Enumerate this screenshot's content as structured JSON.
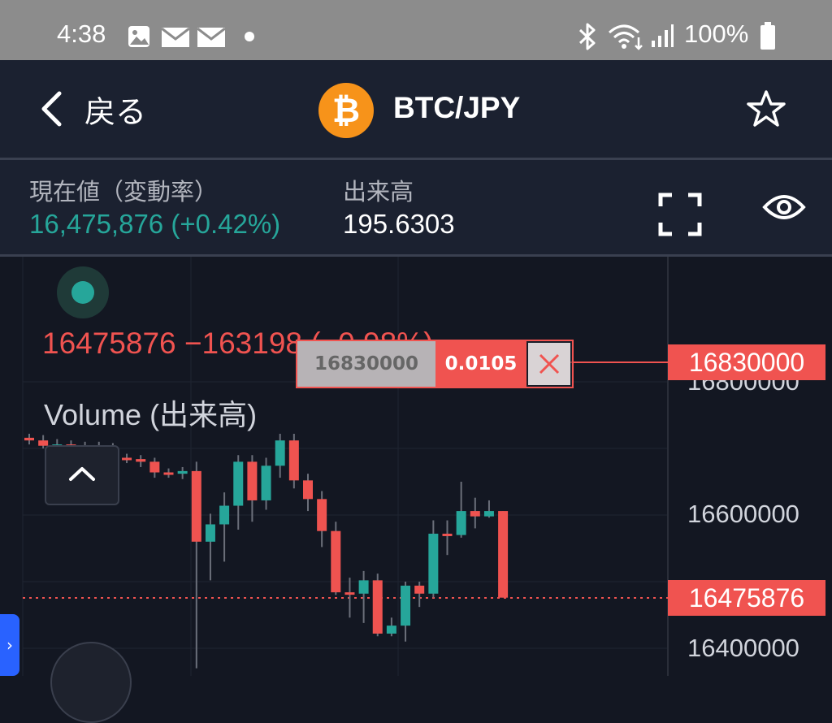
{
  "status_bar": {
    "time": "4:38",
    "battery": "100%",
    "icons": [
      "image-icon",
      "mail-icon",
      "mail-icon",
      "dot-icon",
      "bluetooth-icon",
      "wifi-icon",
      "signal-icon",
      "battery-icon"
    ]
  },
  "header": {
    "back_label": "戻る",
    "coin_symbol": "₿",
    "pair": "BTC/JPY"
  },
  "info": {
    "price_label": "現在値（変動率）",
    "price_value": "16,475,876 (+0.42%)",
    "volume_label": "出来高",
    "volume_value": "195.6303"
  },
  "chart": {
    "legend": "16475876  −163198 (−0.98%)",
    "volume_label": "Volume (出来高)",
    "order": {
      "price": "16830000",
      "qty": "0.0105"
    },
    "tags": {
      "order_price": "16830000",
      "last_price": "16475876"
    },
    "axis_labels": [
      "16800000",
      "16600000",
      "16400000"
    ],
    "colors": {
      "up": "#26a69a",
      "down": "#ef5350",
      "bg": "#131722"
    }
  },
  "chart_data": {
    "type": "candlestick",
    "title": "",
    "axis_range": [
      16400000,
      16800000
    ],
    "current_price": 16475876,
    "order_price": 16830000,
    "candles": [
      {
        "open": 16716000,
        "close": 16712000,
        "high": 16722000,
        "low": 16706000
      },
      {
        "open": 16712000,
        "close": 16704000,
        "high": 16720000,
        "low": 16700000
      },
      {
        "open": 16704000,
        "close": 16706000,
        "high": 16714000,
        "low": 16698000
      },
      {
        "open": 16706000,
        "close": 16703000,
        "high": 16712000,
        "low": 16696000
      },
      {
        "open": 16703000,
        "close": 16704000,
        "high": 16710000,
        "low": 16698000
      },
      {
        "open": 16704000,
        "close": 16702000,
        "high": 16710000,
        "low": 16696000
      },
      {
        "open": 16702000,
        "close": 16686000,
        "high": 16708000,
        "low": 16680000
      },
      {
        "open": 16686000,
        "close": 16684000,
        "high": 16692000,
        "low": 16678000
      },
      {
        "open": 16684000,
        "close": 16680000,
        "high": 16690000,
        "low": 16672000
      },
      {
        "open": 16680000,
        "close": 16664000,
        "high": 16686000,
        "low": 16656000
      },
      {
        "open": 16664000,
        "close": 16662000,
        "high": 16670000,
        "low": 16656000
      },
      {
        "open": 16662000,
        "close": 16666000,
        "high": 16672000,
        "low": 16654000
      },
      {
        "open": 16666000,
        "close": 16560000,
        "high": 16680000,
        "low": 16370000
      },
      {
        "open": 16560000,
        "close": 16586000,
        "high": 16602000,
        "low": 16502000
      },
      {
        "open": 16586000,
        "close": 16614000,
        "high": 16634000,
        "low": 16530000
      },
      {
        "open": 16614000,
        "close": 16680000,
        "high": 16690000,
        "low": 16578000
      },
      {
        "open": 16680000,
        "close": 16622000,
        "high": 16690000,
        "low": 16590000
      },
      {
        "open": 16622000,
        "close": 16674000,
        "high": 16686000,
        "low": 16608000
      },
      {
        "open": 16674000,
        "close": 16712000,
        "high": 16722000,
        "low": 16656000
      },
      {
        "open": 16712000,
        "close": 16652000,
        "high": 16722000,
        "low": 16640000
      },
      {
        "open": 16652000,
        "close": 16624000,
        "high": 16662000,
        "low": 16606000
      },
      {
        "open": 16624000,
        "close": 16576000,
        "high": 16636000,
        "low": 16552000
      },
      {
        "open": 16576000,
        "close": 16484000,
        "high": 16590000,
        "low": 16480000
      },
      {
        "open": 16484000,
        "close": 16482000,
        "high": 16506000,
        "low": 16446000
      },
      {
        "open": 16482000,
        "close": 16502000,
        "high": 16516000,
        "low": 16438000
      },
      {
        "open": 16502000,
        "close": 16422000,
        "high": 16512000,
        "low": 16418000
      },
      {
        "open": 16422000,
        "close": 16434000,
        "high": 16446000,
        "low": 16418000
      },
      {
        "open": 16434000,
        "close": 16494000,
        "high": 16500000,
        "low": 16410000
      },
      {
        "open": 16494000,
        "close": 16482000,
        "high": 16500000,
        "low": 16462000
      },
      {
        "open": 16482000,
        "close": 16572000,
        "high": 16592000,
        "low": 16476000
      },
      {
        "open": 16572000,
        "close": 16570000,
        "high": 16592000,
        "low": 16540000
      },
      {
        "open": 16570000,
        "close": 16606000,
        "high": 16650000,
        "low": 16566000
      },
      {
        "open": 16606000,
        "close": 16598000,
        "high": 16626000,
        "low": 16580000
      },
      {
        "open": 16598000,
        "close": 16606000,
        "high": 16622000,
        "low": 16596000
      },
      {
        "open": 16606000,
        "close": 16476000,
        "high": 16606000,
        "low": 16476000
      }
    ]
  }
}
